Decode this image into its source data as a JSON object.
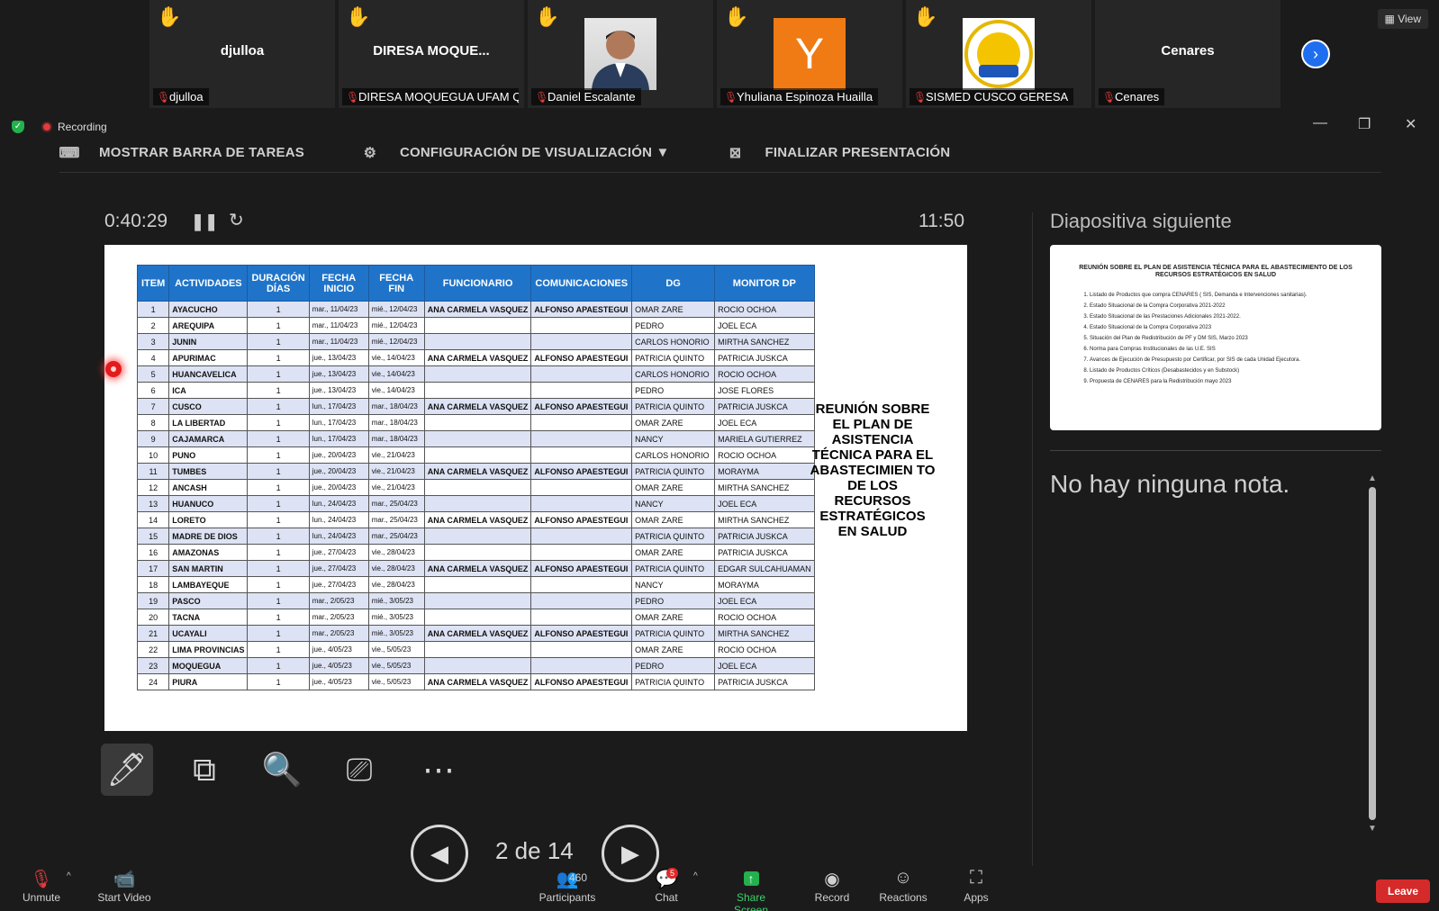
{
  "participants": [
    {
      "big_name": "djulloa",
      "name_tag": "djulloa",
      "type": "name"
    },
    {
      "big_name": "DIRESA  MOQUE...",
      "name_tag": "DIRESA MOQUEGUA UFAM Q...",
      "type": "name"
    },
    {
      "big_name": "",
      "name_tag": "Daniel Escalante",
      "type": "photo"
    },
    {
      "big_name": "Y",
      "name_tag": "Yhuliana Espinoza Huailla",
      "type": "letter"
    },
    {
      "big_name": "",
      "name_tag": "SISMED CUSCO GERESA",
      "type": "logo"
    },
    {
      "big_name": "Cenares",
      "name_tag": "Cenares",
      "type": "name"
    }
  ],
  "view_label": "View",
  "recording_label": "Recording",
  "toolbar": {
    "show_taskbar": "MOSTRAR BARRA DE TAREAS",
    "display_settings": "CONFIGURACIÓN DE VISUALIZACIÓN ▼",
    "end_presentation": "FINALIZAR PRESENTACIÓN"
  },
  "timer": {
    "elapsed": "0:40:29",
    "clock": "11:50"
  },
  "slide": {
    "headers": [
      "ITEM",
      "ACTIVIDADES",
      "DURACIÓN DÍAS",
      "FECHA INICIO",
      "FECHA FIN",
      "FUNCIONARIO",
      "COMUNICACIONES",
      "DG",
      "MONITOR DP"
    ],
    "rows": [
      [
        "1",
        "AYACUCHO",
        "1",
        "mar., 11/04/23",
        "mié., 12/04/23",
        "ANA CARMELA VASQUEZ",
        "ALFONSO APAESTEGUI",
        "OMAR ZARE",
        "ROCIO OCHOA"
      ],
      [
        "2",
        "AREQUIPA",
        "1",
        "mar., 11/04/23",
        "mié., 12/04/23",
        "",
        "",
        "PEDRO",
        "JOEL ECA"
      ],
      [
        "3",
        "JUNIN",
        "1",
        "mar., 11/04/23",
        "mié., 12/04/23",
        "",
        "",
        "CARLOS HONORIO",
        "MIRTHA SANCHEZ"
      ],
      [
        "4",
        "APURIMAC",
        "1",
        "jue., 13/04/23",
        "vie., 14/04/23",
        "ANA CARMELA VASQUEZ",
        "ALFONSO APAESTEGUI",
        "PATRICIA QUINTO",
        "PATRICIA JUSKCA"
      ],
      [
        "5",
        "HUANCAVELICA",
        "1",
        "jue., 13/04/23",
        "vie., 14/04/23",
        "",
        "",
        "CARLOS HONORIO",
        "ROCIO OCHOA"
      ],
      [
        "6",
        "ICA",
        "1",
        "jue., 13/04/23",
        "vie., 14/04/23",
        "",
        "",
        "PEDRO",
        "JOSE FLORES"
      ],
      [
        "7",
        "CUSCO",
        "1",
        "lun., 17/04/23",
        "mar., 18/04/23",
        "ANA CARMELA VASQUEZ",
        "ALFONSO APAESTEGUI",
        "PATRICIA QUINTO",
        "PATRICIA JUSKCA"
      ],
      [
        "8",
        "LA LIBERTAD",
        "1",
        "lun., 17/04/23",
        "mar., 18/04/23",
        "",
        "",
        "OMAR ZARE",
        "JOEL ECA"
      ],
      [
        "9",
        "CAJAMARCA",
        "1",
        "lun., 17/04/23",
        "mar., 18/04/23",
        "",
        "",
        "NANCY",
        "MARIELA GUTIERREZ"
      ],
      [
        "10",
        "PUNO",
        "1",
        "jue., 20/04/23",
        "vie., 21/04/23",
        "",
        "",
        "CARLOS HONORIO",
        "ROCIO OCHOA"
      ],
      [
        "11",
        "TUMBES",
        "1",
        "jue., 20/04/23",
        "vie., 21/04/23",
        "ANA CARMELA VASQUEZ",
        "ALFONSO APAESTEGUI",
        "PATRICIA QUINTO",
        "MORAYMA"
      ],
      [
        "12",
        "ANCASH",
        "1",
        "jue., 20/04/23",
        "vie., 21/04/23",
        "",
        "",
        "OMAR ZARE",
        "MIRTHA SANCHEZ"
      ],
      [
        "13",
        "HUANUCO",
        "1",
        "lun., 24/04/23",
        "mar., 25/04/23",
        "",
        "",
        "NANCY",
        "JOEL ECA"
      ],
      [
        "14",
        "LORETO",
        "1",
        "lun., 24/04/23",
        "mar., 25/04/23",
        "ANA CARMELA VASQUEZ",
        "ALFONSO APAESTEGUI",
        "OMAR ZARE",
        "MIRTHA SANCHEZ"
      ],
      [
        "15",
        "MADRE DE DIOS",
        "1",
        "lun., 24/04/23",
        "mar., 25/04/23",
        "",
        "",
        "PATRICIA QUINTO",
        "PATRICIA JUSKCA"
      ],
      [
        "16",
        "AMAZONAS",
        "1",
        "jue., 27/04/23",
        "vie., 28/04/23",
        "",
        "",
        "OMAR ZARE",
        "PATRICIA JUSKCA"
      ],
      [
        "17",
        "SAN MARTIN",
        "1",
        "jue., 27/04/23",
        "vie., 28/04/23",
        "ANA CARMELA VASQUEZ",
        "ALFONSO APAESTEGUI",
        "PATRICIA QUINTO",
        "EDGAR SULCAHUAMAN"
      ],
      [
        "18",
        "LAMBAYEQUE",
        "1",
        "jue., 27/04/23",
        "vie., 28/04/23",
        "",
        "",
        "NANCY",
        "MORAYMA"
      ],
      [
        "19",
        "PASCO",
        "1",
        "mar., 2/05/23",
        "mié., 3/05/23",
        "",
        "",
        "PEDRO",
        "JOEL ECA"
      ],
      [
        "20",
        "TACNA",
        "1",
        "mar., 2/05/23",
        "mié., 3/05/23",
        "",
        "",
        "OMAR ZARE",
        "ROCIO OCHOA"
      ],
      [
        "21",
        "UCAYALI",
        "1",
        "mar., 2/05/23",
        "mié., 3/05/23",
        "ANA CARMELA VASQUEZ",
        "ALFONSO APAESTEGUI",
        "PATRICIA QUINTO",
        "MIRTHA SANCHEZ"
      ],
      [
        "22",
        "LIMA PROVINCIAS",
        "1",
        "jue., 4/05/23",
        "vie., 5/05/23",
        "",
        "",
        "OMAR ZARE",
        "ROCIO OCHOA"
      ],
      [
        "23",
        "MOQUEGUA",
        "1",
        "jue., 4/05/23",
        "vie., 5/05/23",
        "",
        "",
        "PEDRO",
        "JOEL ECA"
      ],
      [
        "24",
        "PIURA",
        "1",
        "jue., 4/05/23",
        "vie., 5/05/23",
        "ANA CARMELA VASQUEZ",
        "ALFONSO APAESTEGUI",
        "PATRICIA QUINTO",
        "PATRICIA JUSKCA"
      ]
    ],
    "title": "REUNIÓN SOBRE EL PLAN DE ASISTENCIA TÉCNICA PARA EL ABASTECIMIEN TO DE LOS RECURSOS ESTRATÉGICOS EN SALUD"
  },
  "pager": {
    "label": "2 de 14"
  },
  "next_slide": {
    "heading": "Diapositiva siguiente",
    "title": "REUNIÓN SOBRE EL PLAN DE ASISTENCIA TÉCNICA PARA EL ABASTECIMIENTO DE LOS RECURSOS ESTRATÉGICOS EN SALUD",
    "items": [
      "Listado de Productos que compra CENARES ( SIS, Demanda e Intervenciones sanitarias).",
      "Estado Situacional de la Compra Corporativa 2021-2022",
      "Estado Situacional de las Prestaciones Adicionales 2021-2022.",
      "Estado Situacional de la Compra Corporativa 2023",
      "Situación del Plan de Redistribución de PF y DM SIS, Marzo 2023",
      "Norma para Compras Institucionales de las U.E. SIS",
      "Avances de Ejecución de Presupuesto por Certificar, por SIS de cada Unidad Ejecutora.",
      "Listado de Productos Críticos (Desabastecidos y en Substock)",
      "Propuesta de CENARES para la Redistribución mayo 2023"
    ]
  },
  "notes": "No hay ninguna nota.",
  "bottom_bar": {
    "unmute": "Unmute",
    "start_video": "Start Video",
    "participants": "Participants",
    "participants_count": "460",
    "chat": "Chat",
    "chat_badge": "5",
    "share_screen": "Share Screen",
    "record": "Record",
    "reactions": "Reactions",
    "apps": "Apps",
    "leave": "Leave"
  }
}
